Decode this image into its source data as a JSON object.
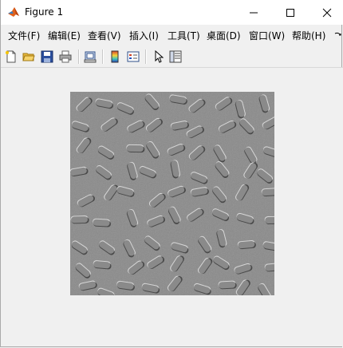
{
  "window": {
    "title": "Figure 1",
    "icon": "matlab-logo-icon",
    "controls": [
      "minimize-icon",
      "maximize-icon",
      "close-icon"
    ]
  },
  "menubar": {
    "items": [
      {
        "label": "文件(F)"
      },
      {
        "label": "编辑(E)"
      },
      {
        "label": "查看(V)"
      },
      {
        "label": "插入(I)"
      },
      {
        "label": "工具(T)"
      },
      {
        "label": "桌面(D)"
      },
      {
        "label": "窗口(W)"
      },
      {
        "label": "帮助(H)"
      }
    ],
    "overflow_icon": "menu-overflow-arrow-icon"
  },
  "toolbar": {
    "buttons": [
      "new-figure-icon",
      "open-file-icon",
      "save-icon",
      "print-icon",
      "link-plot-icon",
      "insert-colorbar-icon",
      "insert-legend-icon",
      "edit-plot-icon",
      "property-inspector-icon"
    ]
  },
  "axes": {
    "content": "embossed-rice-grains-image",
    "colors": {
      "image_gray": "#8a8a8a",
      "highlight": "#d6d6d6",
      "shadow": "#4a4a4a"
    }
  }
}
